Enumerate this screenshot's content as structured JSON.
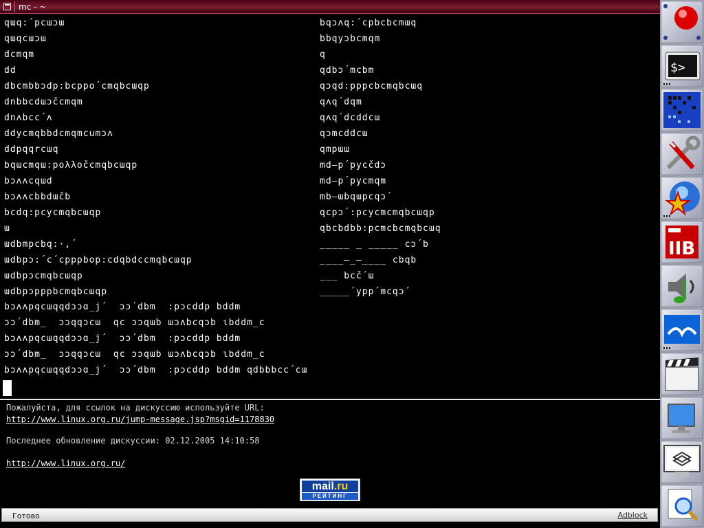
{
  "terminal": {
    "title": "mc - ~",
    "left_lines": [
      "qɯq:´pcɯɔɯ",
      "qɯqcɯɔɯ",
      "dcmqm",
      "dd",
      "dbcmbbɔdp:bcppo´cmqbcɯqp",
      "dnbbcdɯɔčcmqm",
      "dnʌbcc´ʌ",
      "ddycmqbbdcmqmcumɔʌ",
      "ddpqqrcɯq",
      "bqɯcmqɯ:poλλočcmqbcɯqp",
      "bɔʌʌcqɯd",
      "bɔʌʌcbbdɯčb",
      "bcdq:pcycmqbcɯqp",
      "ɯ",
      "ɯdbmpcbq:·,´",
      "ɯdbpɔ:´c´cpppbop:cdqbdccmqbcɯqp",
      "ɯdbpɔcmqbcɯqp",
      "ɯdbpɔpppbcmqbcɯqp"
    ],
    "right_lines": [
      "bqɔʌq:´cpbcbcmɯq",
      "bbqyɔbcmqm",
      "q",
      "qdbɔ´mcbm",
      "qɔqd:pppcbcmqbcɯq",
      "qʌq´dqm",
      "qʌq´dcddcɯ",
      "qɔmcddcɯ",
      "qmpɯɯ",
      "md–p´pycčdɔ",
      "md–p´pycmqm",
      "mb–ɯbqɯpcqɔ´",
      "qcpɔ´:pcycmcmqbcɯqp",
      "qbcbdbb:pcmcbcmqbcɯq",
      "_____ _ _____ cɔ´b",
      "____–_–____ cbqb",
      "___ bcč´ɯ",
      "_____´ypp´mcqɔ´"
    ],
    "prompt_lines": [
      "bɔʌʌpqcɯqqdɔɔɑ_j´  ɔɔ´dbm  :pɔcddp bddm",
      "ɔɔ´dbm_  ɔɔqqɔcɯ  qc ɔɔqɯb ɯɔʌbcqɔb ɩbddm_c",
      "bɔʌʌpqcɯqqdɔɔɑ_j´  ɔɔ´dbm  :pɔcddp bddm",
      "ɔɔ´dbm_  ɔɔqqɔcɯ  qc ɔɔqɯb ɯɔʌbcqɔb ɩbddm_c",
      "bɔʌʌpqcɯqqdɔɔɑ_j´  ɔɔ´dbm  :pɔcddp bddm qdbbbcc´cɯ"
    ]
  },
  "page": {
    "notice": "Пожалуйста, для ссылок на дискуссию используйте URL:",
    "discussion_url": "http://www.linux.org.ru/jump-message.jsp?msgid=1178830",
    "last_update": "Последнее обновление дискуссии: 02.12.2005 14:10:58",
    "home_url": "http://www.linux.org.ru/",
    "rating_logo": {
      "main": "mail",
      "suffix": ".ru",
      "sub": "РЕЙТИНГ"
    }
  },
  "status_bar": {
    "text": "Готово",
    "adblock": "Adblock"
  },
  "dock": {
    "items": [
      {
        "name": "record-button-icon"
      },
      {
        "name": "terminal-icon"
      },
      {
        "name": "pager-workspaces-icon"
      },
      {
        "name": "settings-tools-icon"
      },
      {
        "name": "browser-icon"
      },
      {
        "name": "text-editor-icon"
      },
      {
        "name": "audio-player-icon"
      },
      {
        "name": "office-icon"
      },
      {
        "name": "video-player-icon"
      },
      {
        "name": "display-settings-icon"
      },
      {
        "name": "window-manager-icon"
      },
      {
        "name": "file-search-icon"
      }
    ]
  },
  "colors": {
    "title_bar": "#7a1c30",
    "terminal_bg": "#000000",
    "terminal_fg": "#ffffff",
    "dock_bg": "#a8acb8"
  }
}
